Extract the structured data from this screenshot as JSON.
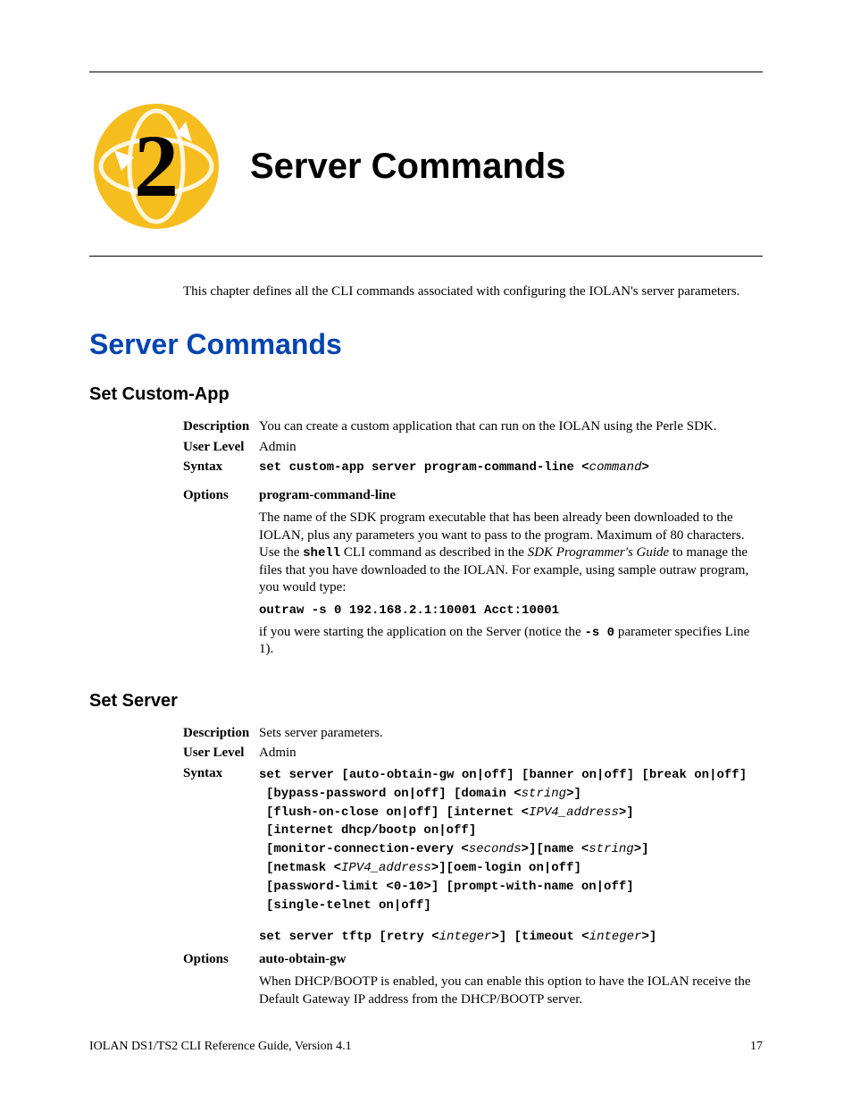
{
  "chapter": {
    "number": "2",
    "title": "Server Commands"
  },
  "intro": "This chapter defines all the CLI commands associated with configuring the IOLAN's server parameters.",
  "section_heading": "Server Commands",
  "set_custom_app": {
    "heading": "Set Custom-App",
    "description_label": "Description",
    "description": "You can create a custom application that can run on the IOLAN using the Perle SDK.",
    "user_level_label": "User Level",
    "user_level": "Admin",
    "syntax_label": "Syntax",
    "syntax_prefix": "set custom-app server program-command-line <",
    "syntax_param": "command",
    "syntax_suffix": ">",
    "options_label": "Options",
    "option_name": "program-command-line",
    "option_text_1a": "The name of the SDK program executable that has been already been downloaded to the IOLAN, plus any parameters you want to pass to the program. Maximum of 80 characters. Use the ",
    "option_text_1b_mono": "shell",
    "option_text_1c": " CLI command as described in the ",
    "option_text_1d_italic": "SDK Programmer's Guide",
    "option_text_1e": " to manage the files that you have downloaded to the IOLAN. For example, using sample outraw program, you would type:",
    "option_example": "outraw -s 0 192.168.2.1:10001 Acct:10001",
    "option_text_2a": "if you were starting the application on the Server (notice the ",
    "option_text_2b_mono": "-s 0",
    "option_text_2c": " parameter specifies Line 1)."
  },
  "set_server": {
    "heading": "Set Server",
    "description_label": "Description",
    "description": "Sets server parameters.",
    "user_level_label": "User Level",
    "user_level": "Admin",
    "syntax_label": "Syntax",
    "syntax_lines": {
      "l1a": "set server [auto-obtain-gw on|off] [banner on|off] [break on|off]",
      "l2a": "[bypass-password on|off] [domain <",
      "l2b": "string",
      "l2c": ">]",
      "l3a": "[flush-on-close on|off] [internet <",
      "l3b": "IPV4_address",
      "l3c": ">]",
      "l4a": "[internet dhcp/bootp on|off]",
      "l5a": "[monitor-connection-every <",
      "l5b": "seconds",
      "l5c": ">][name <",
      "l5d": "string",
      "l5e": ">]",
      "l6a": "[netmask <",
      "l6b": "IPV4_address",
      "l6c": ">][oem-login on|off]",
      "l7a": "[password-limit <0-10>] [prompt-with-name on|off]",
      "l8a": "[single-telnet on|off]",
      "l10a": "set server tftp [retry <",
      "l10b": "integer",
      "l10c": ">] [timeout <",
      "l10d": "integer",
      "l10e": ">]"
    },
    "options_label": "Options",
    "option_name": "auto-obtain-gw",
    "option_text": "When DHCP/BOOTP is enabled, you can enable this option to have the IOLAN receive the Default Gateway IP address from the DHCP/BOOTP server."
  },
  "footer": {
    "left": "IOLAN DS1/TS2 CLI Reference Guide, Version 4.1",
    "right": "17"
  }
}
